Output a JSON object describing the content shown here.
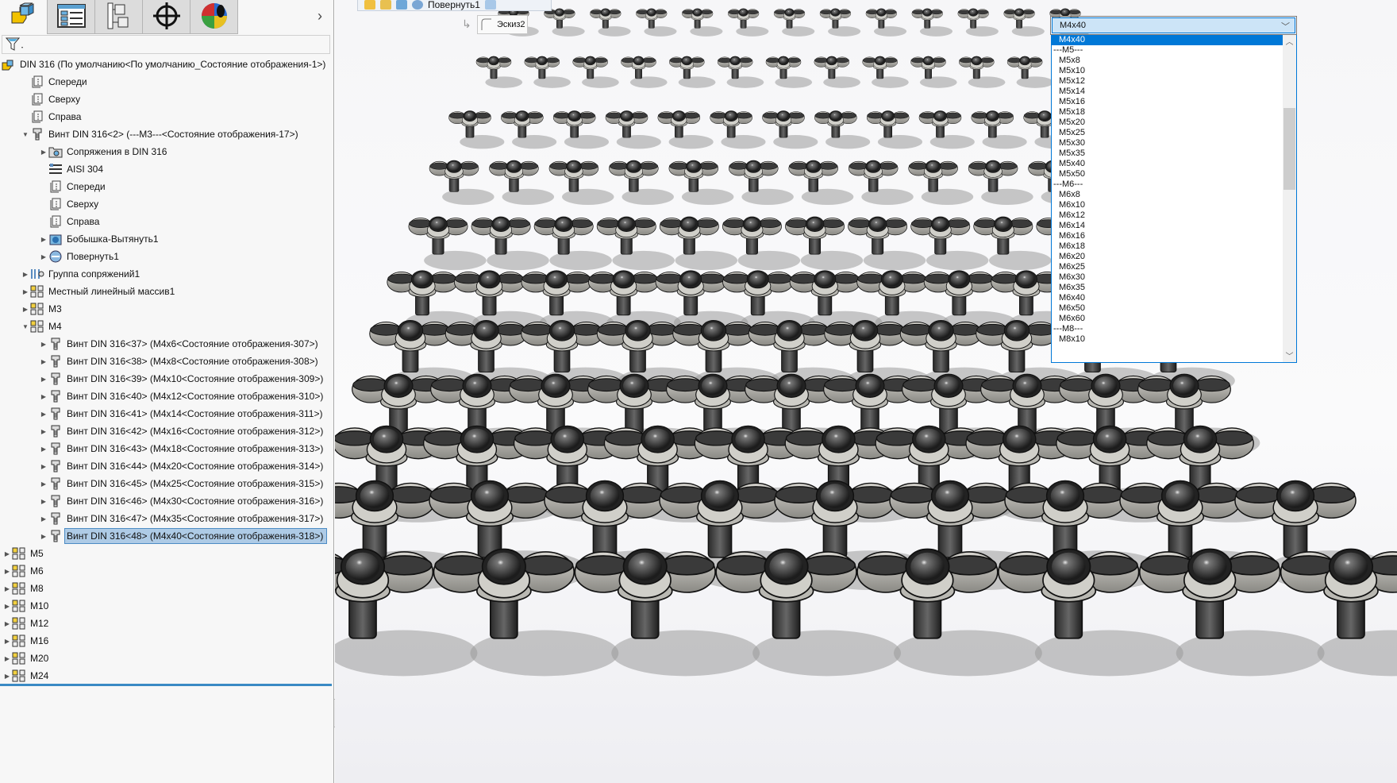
{
  "left_panel": {
    "tabs": [
      {
        "name": "feature-manager-tab",
        "icon": "part-icon"
      },
      {
        "name": "property-manager-tab",
        "icon": "list-icon"
      },
      {
        "name": "configuration-manager-tab",
        "icon": "config-tree-icon"
      },
      {
        "name": "dimxpert-tab",
        "icon": "crosshair-icon"
      },
      {
        "name": "display-manager-tab",
        "icon": "appearance-sphere-icon"
      }
    ],
    "more": "›",
    "tree": [
      {
        "level": 0,
        "tw": "",
        "icon": "assembly",
        "label": "DIN 316  (По умолчанию<По умолчанию_Состояние отображения-1>)"
      },
      {
        "level": 1,
        "tw": "",
        "icon": "plane",
        "label": "Спереди"
      },
      {
        "level": 1,
        "tw": "",
        "icon": "plane",
        "label": "Сверху"
      },
      {
        "level": 1,
        "tw": "",
        "icon": "plane",
        "label": "Справа"
      },
      {
        "level": 1,
        "tw": "▼",
        "icon": "screw",
        "label": "Винт DIN 316<2>  (---M3---<Состояние отображения-17>)"
      },
      {
        "level": 2,
        "tw": "▶",
        "icon": "mates",
        "label": "Сопряжения в DIN 316"
      },
      {
        "level": 2,
        "tw": "",
        "icon": "material",
        "label": "AISI 304"
      },
      {
        "level": 2,
        "tw": "",
        "icon": "plane",
        "label": "Спереди"
      },
      {
        "level": 2,
        "tw": "",
        "icon": "plane",
        "label": "Сверху"
      },
      {
        "level": 2,
        "tw": "",
        "icon": "plane",
        "label": "Справа"
      },
      {
        "level": 2,
        "tw": "▶",
        "icon": "boss",
        "label": "Бобышка-Вытянуть1"
      },
      {
        "level": 2,
        "tw": "▶",
        "icon": "revolve",
        "label": "Повернуть1"
      },
      {
        "level": 1,
        "tw": "▶",
        "icon": "mategroup",
        "label": "Группа сопряжений1"
      },
      {
        "level": 1,
        "tw": "▶",
        "icon": "pattern",
        "label": "Местный линейный массив1"
      },
      {
        "level": 1,
        "tw": "▶",
        "icon": "folder",
        "label": "M3"
      },
      {
        "level": 1,
        "tw": "▼",
        "icon": "folder",
        "label": "M4"
      },
      {
        "level": 2,
        "tw": "▶",
        "icon": "screw",
        "label": "Винт DIN 316<37>  (M4x6<Состояние отображения-307>)"
      },
      {
        "level": 2,
        "tw": "▶",
        "icon": "screw",
        "label": "Винт DIN 316<38>  (M4x8<Состояние отображения-308>)"
      },
      {
        "level": 2,
        "tw": "▶",
        "icon": "screw",
        "label": "Винт DIN 316<39>  (M4x10<Состояние отображения-309>)"
      },
      {
        "level": 2,
        "tw": "▶",
        "icon": "screw",
        "label": "Винт DIN 316<40>  (M4x12<Состояние отображения-310>)"
      },
      {
        "level": 2,
        "tw": "▶",
        "icon": "screw",
        "label": "Винт DIN 316<41>  (M4x14<Состояние отображения-311>)"
      },
      {
        "level": 2,
        "tw": "▶",
        "icon": "screw",
        "label": "Винт DIN 316<42>  (M4x16<Состояние отображения-312>)"
      },
      {
        "level": 2,
        "tw": "▶",
        "icon": "screw",
        "label": "Винт DIN 316<43>  (M4x18<Состояние отображения-313>)"
      },
      {
        "level": 2,
        "tw": "▶",
        "icon": "screw",
        "label": "Винт DIN 316<44>  (M4x20<Состояние отображения-314>)"
      },
      {
        "level": 2,
        "tw": "▶",
        "icon": "screw",
        "label": "Винт DIN 316<45>  (M4x25<Состояние отображения-315>)"
      },
      {
        "level": 2,
        "tw": "▶",
        "icon": "screw",
        "label": "Винт DIN 316<46>  (M4x30<Состояние отображения-316>)"
      },
      {
        "level": 2,
        "tw": "▶",
        "icon": "screw",
        "label": "Винт DIN 316<47>  (M4x35<Состояние отображения-317>)"
      },
      {
        "level": 2,
        "tw": "▶",
        "icon": "screw",
        "label": "Винт DIN 316<48>  (M4x40<Состояние отображения-318>)",
        "selected": true
      },
      {
        "level": 0,
        "tw": "▶",
        "icon": "folder",
        "label": "M5"
      },
      {
        "level": 0,
        "tw": "▶",
        "icon": "folder",
        "label": "M6"
      },
      {
        "level": 0,
        "tw": "▶",
        "icon": "folder",
        "label": "M8"
      },
      {
        "level": 0,
        "tw": "▶",
        "icon": "folder",
        "label": "M10"
      },
      {
        "level": 0,
        "tw": "▶",
        "icon": "folder",
        "label": "M12"
      },
      {
        "level": 0,
        "tw": "▶",
        "icon": "folder",
        "label": "M16"
      },
      {
        "level": 0,
        "tw": "▶",
        "icon": "folder",
        "label": "M20"
      },
      {
        "level": 0,
        "tw": "▶",
        "icon": "folder",
        "label": "M24"
      }
    ]
  },
  "viewport": {
    "breadcrumb_label": "Повернуть1",
    "sketch_label": "Эскиз2",
    "colors": {
      "accent": "#0078d7",
      "selection": "#aecbe6"
    }
  },
  "config_dropdown": {
    "value": "M4x40",
    "options": [
      "M4x40",
      "---M5---",
      "M5x8",
      "M5x10",
      "M5x12",
      "M5x14",
      "M5x16",
      "M5x18",
      "M5x20",
      "M5x25",
      "M5x30",
      "M5x35",
      "M5x40",
      "M5x50",
      "---M6---",
      "M6x8",
      "M6x10",
      "M6x12",
      "M6x14",
      "M6x16",
      "M6x18",
      "M6x20",
      "M6x25",
      "M6x30",
      "M6x35",
      "M6x40",
      "M6x50",
      "M6x60",
      "---M8---",
      "M8x10"
    ],
    "selected_index": 0
  }
}
